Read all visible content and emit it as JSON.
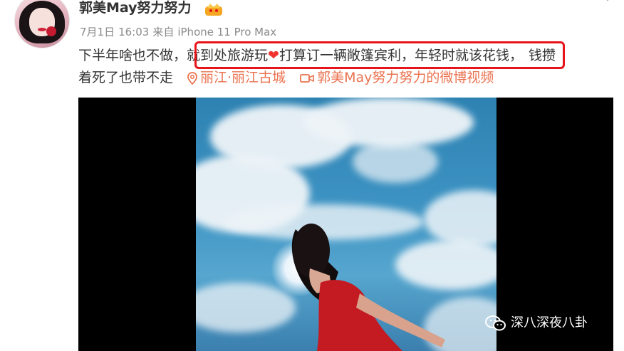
{
  "user": {
    "name": "郭美May努力努力",
    "badge_icon": "vip-crown-icon",
    "badge_color": "#f5a623"
  },
  "meta": {
    "date": "7月1日",
    "time": "16:03",
    "source_prefix": "来自",
    "device": "iPhone 11 Pro Max"
  },
  "post": {
    "text_before": "下半年啥也不做，",
    "highlighted_text_1": "就到处旅游玩",
    "heart_emoji": "❤",
    "highlighted_text_2": "打算订一辆敞篷宾利，年轻时就该花钱，",
    "text_after_line1": "钱攒",
    "text_line2": "着死了也带不走",
    "location_tag": "丽江·丽江古城",
    "video_tag": "郭美May努力努力的微博视频",
    "tag_color": "#eb7350",
    "highlight_color": "#e8141b"
  },
  "media": {
    "type": "video-thumbnail",
    "background_color": "#000000"
  },
  "watermark": {
    "icon": "wechat-icon",
    "text": "深八深夜八卦"
  }
}
